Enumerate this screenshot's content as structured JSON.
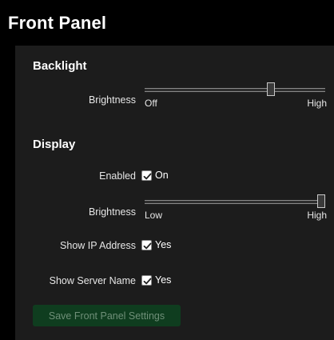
{
  "page": {
    "title": "Front Panel"
  },
  "backlight": {
    "section_title": "Backlight",
    "brightness": {
      "label": "Brightness",
      "min_label": "Off",
      "max_label": "High",
      "value_fraction": 0.7
    }
  },
  "display": {
    "section_title": "Display",
    "enabled": {
      "label": "Enabled",
      "checked": true,
      "value_label": "On"
    },
    "brightness": {
      "label": "Brightness",
      "min_label": "Low",
      "max_label": "High",
      "value_fraction": 1.0
    },
    "show_ip": {
      "label": "Show IP Address",
      "checked": true,
      "value_label": "Yes"
    },
    "show_server_name": {
      "label": "Show Server Name",
      "checked": true,
      "value_label": "Yes"
    }
  },
  "actions": {
    "save_label": "Save Front Panel Settings"
  },
  "colors": {
    "page_background": "#000000",
    "panel_background": "#1c1c1c",
    "button_background": "#0f3d1f",
    "button_text_disabled": "#6f8f78"
  },
  "icons": {
    "checkbox_checked": "checkmark-icon"
  }
}
